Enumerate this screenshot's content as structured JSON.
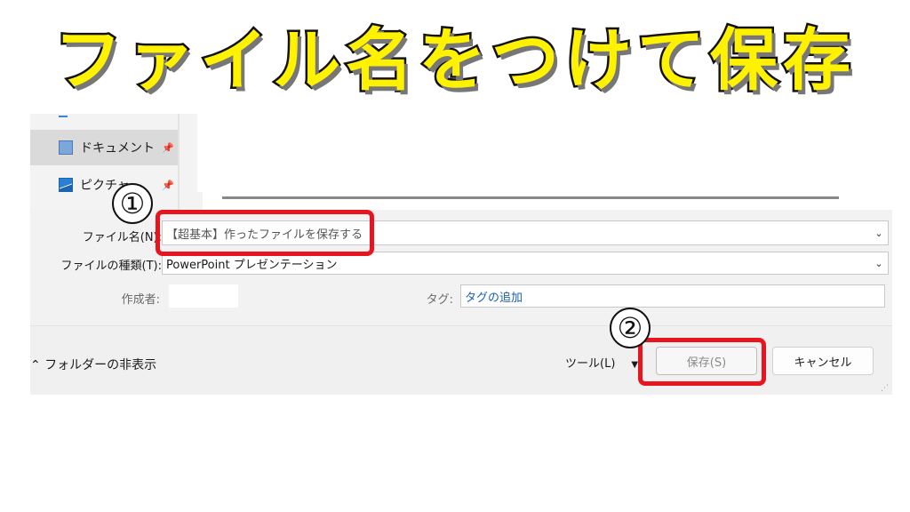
{
  "headline": "ファイル名をつけて保存",
  "nav": {
    "items": [
      {
        "label": "ドキュメント",
        "icon": "document-icon",
        "selected": true,
        "pinned": true
      },
      {
        "label": "ピクチャ",
        "icon": "pictures-icon",
        "selected": false,
        "pinned": true
      }
    ]
  },
  "form": {
    "filename_label": "ファイル名(N):",
    "filename_value": "【超基本】作ったファイルを保存する",
    "filetype_label": "ファイルの種類(T):",
    "filetype_value": "PowerPoint プレゼンテーション",
    "author_label": "作成者:",
    "author_value": "",
    "tags_label": "タグ:",
    "tags_value": "タグの追加"
  },
  "footer": {
    "toggle_icon": "chevron-up-icon",
    "hide_folders_label": "フォルダーの非表示",
    "tools_label": "ツール(L)",
    "save_label": "保存(S)",
    "cancel_label": "キャンセル"
  },
  "annotations": {
    "step1": "①",
    "step2": "②",
    "highlight_color": "#e8151e"
  },
  "colors": {
    "headline_fill": "#fff200",
    "headline_stroke": "#111111",
    "tag_link": "#1a5fb4"
  }
}
